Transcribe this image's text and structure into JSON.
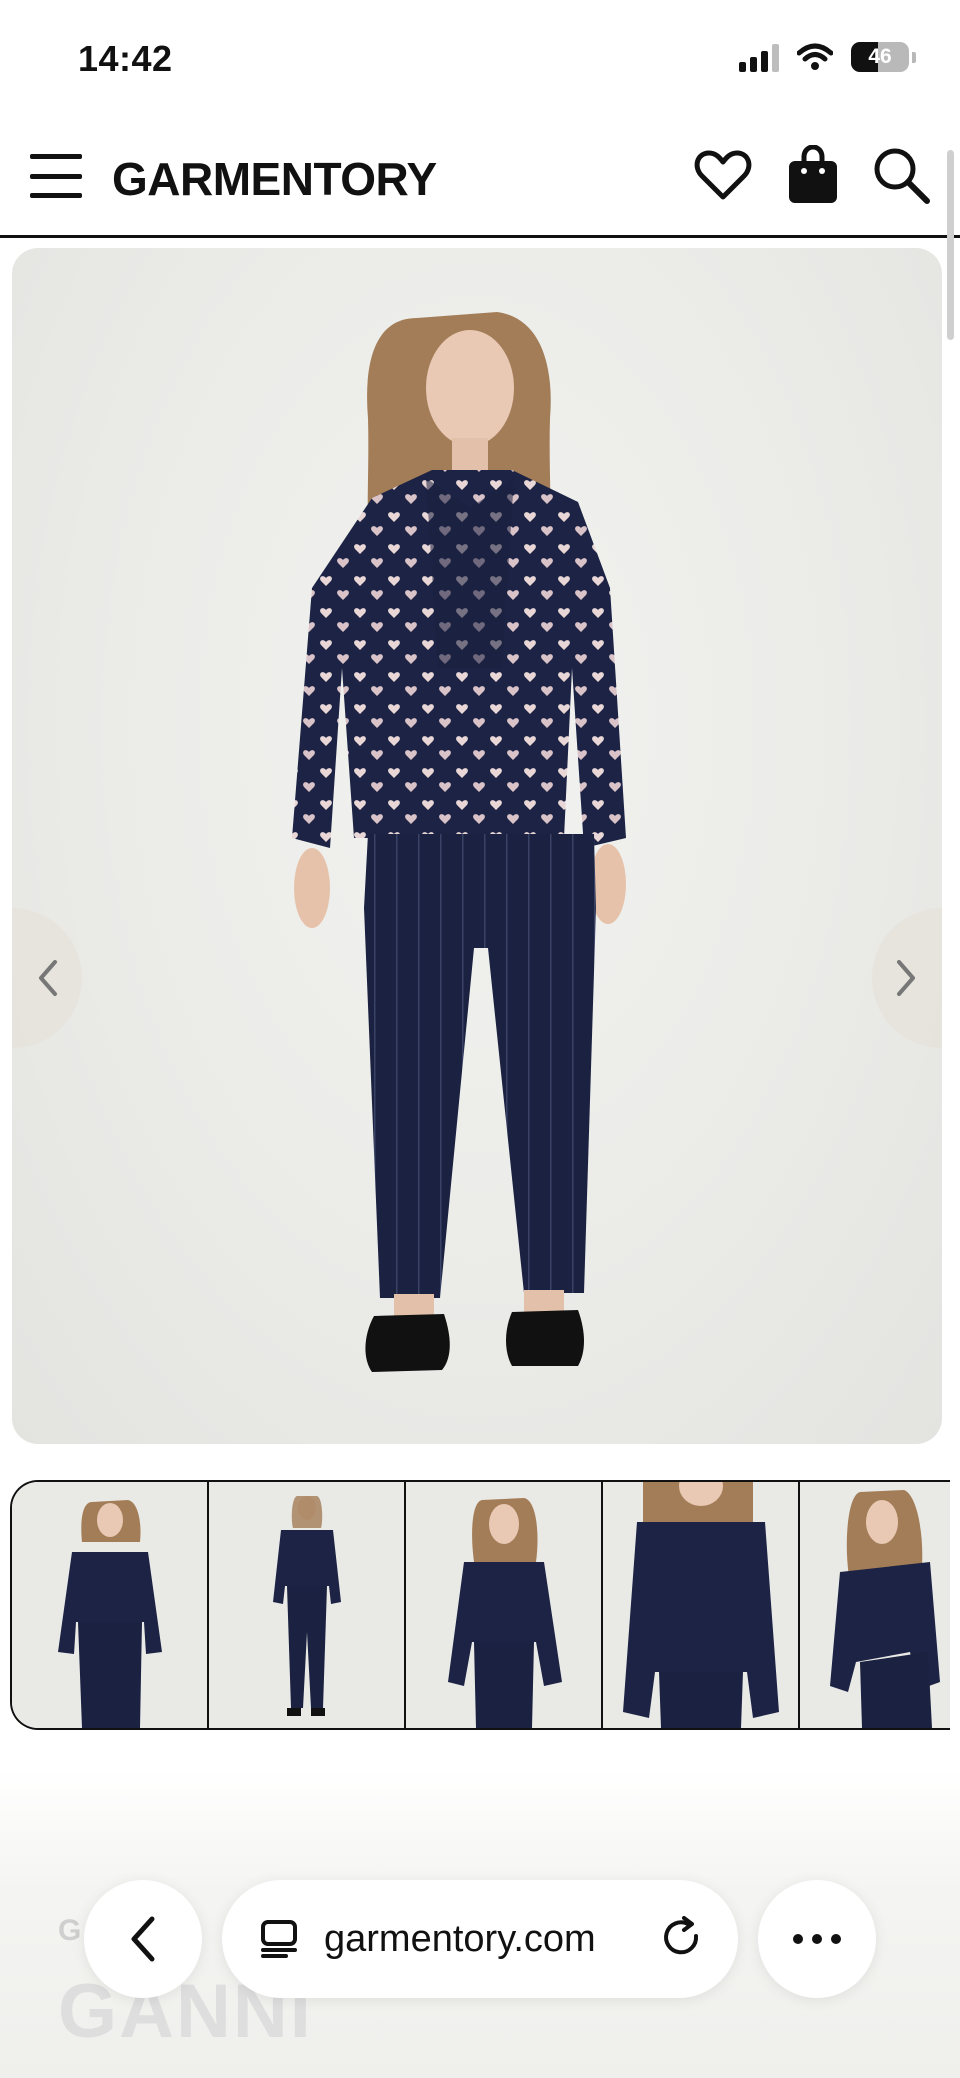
{
  "status_bar": {
    "time": "14:42",
    "battery_percent": "46",
    "icons": [
      "signal-icon",
      "wifi-icon",
      "battery-icon"
    ]
  },
  "header": {
    "brand": "GARMENTORY",
    "icons": [
      "menu-icon",
      "heart-icon",
      "shopping-bag-icon",
      "search-icon"
    ]
  },
  "gallery": {
    "main_image_alt": "Model wearing navy heart print ruffle blouse with navy pinstripe trousers",
    "thumbnail_count": 5,
    "nav": [
      "chevron-left-icon",
      "chevron-right-icon"
    ]
  },
  "product_preview": {
    "subtitle_partial": "G… W…",
    "brand_partial": "GANNI"
  },
  "browser": {
    "url": "garmentory.com",
    "icons": [
      "back-icon",
      "tabs-icon",
      "reload-icon",
      "more-icon"
    ]
  },
  "colors": {
    "navy": "#1c2344",
    "background": "#ebebe8",
    "ink": "#111111"
  }
}
